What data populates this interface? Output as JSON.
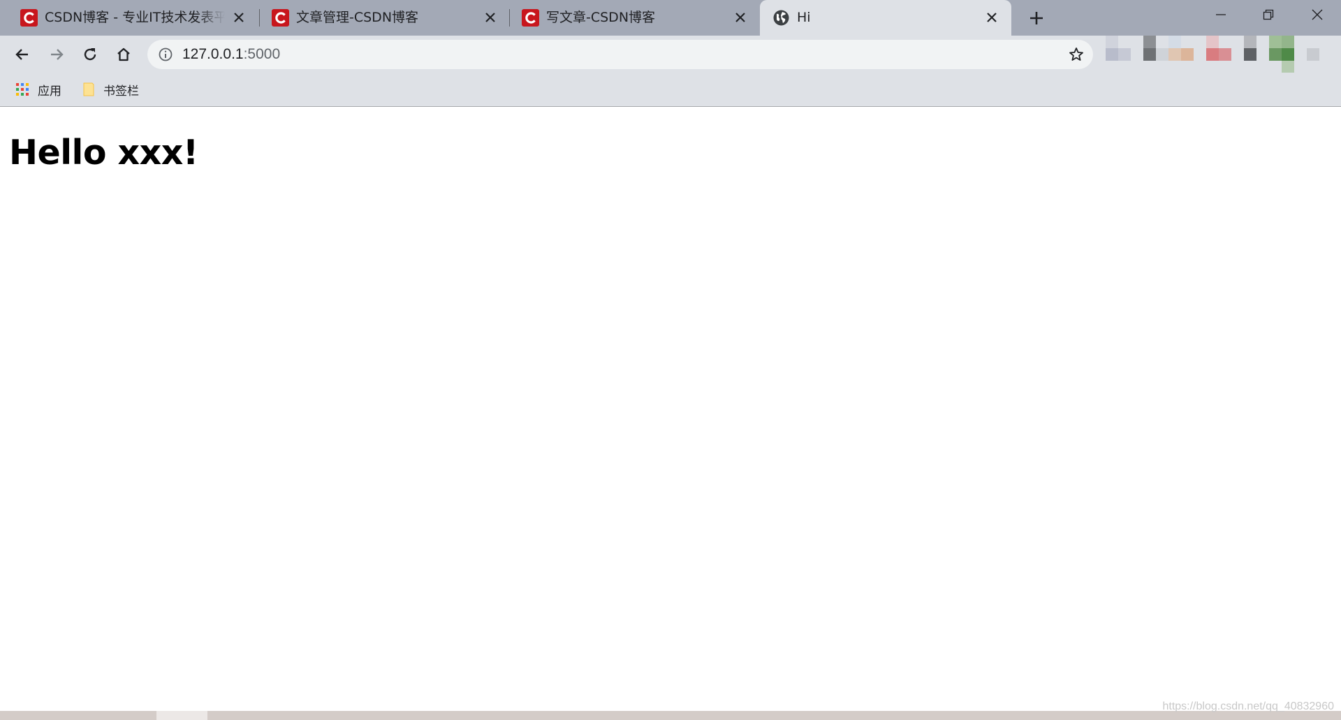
{
  "browser": {
    "tabs": [
      {
        "title": "CSDN博客 - 专业IT技术发表平台",
        "favicon": "csdn-icon",
        "active": false
      },
      {
        "title": "文章管理-CSDN博客",
        "favicon": "csdn-icon",
        "active": false
      },
      {
        "title": "写文章-CSDN博客",
        "favicon": "csdn-icon",
        "active": false
      },
      {
        "title": "Hi",
        "favicon": "globe-icon",
        "active": true
      }
    ],
    "toolbar": {
      "url_host": "127.0.0.1",
      "url_port": ":5000"
    },
    "bookmarks": [
      {
        "label": "应用",
        "icon": "apps-grid-icon"
      },
      {
        "label": "书签栏",
        "icon": "folder-icon"
      }
    ]
  },
  "page": {
    "heading": "Hello xxx!"
  },
  "watermark": "https://blog.csdn.net/qq_40832960",
  "colors": {
    "csdn_red": "#c8161d",
    "tabstrip_bg": "#a3a9b6",
    "toolbar_bg": "#dee1e6",
    "omnibox_bg": "#f1f3f4"
  }
}
